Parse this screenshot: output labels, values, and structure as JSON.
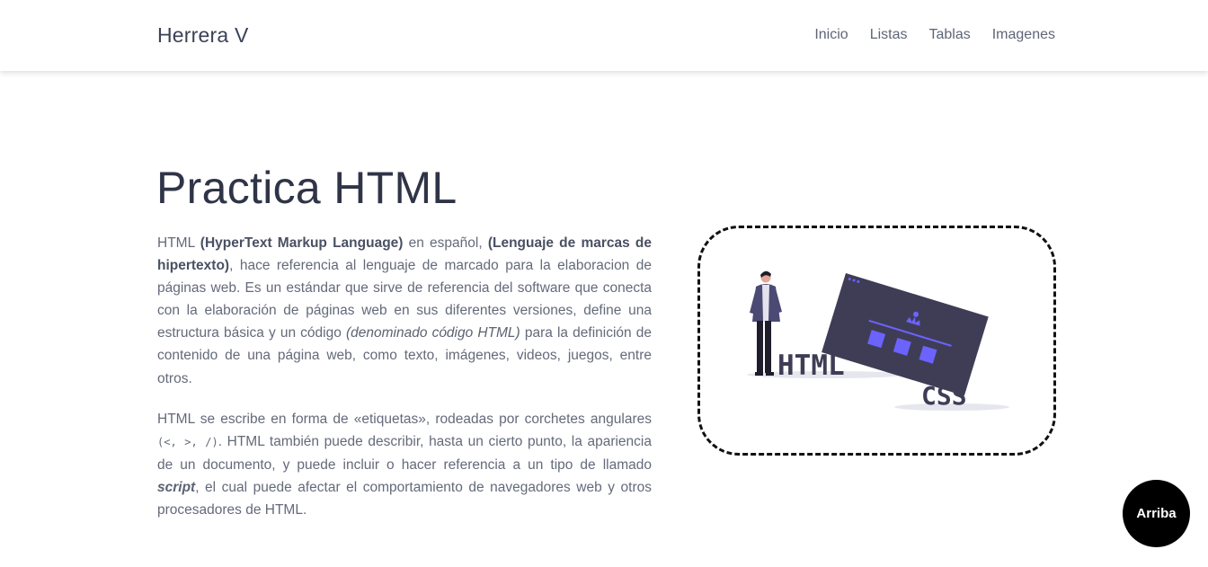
{
  "navbar": {
    "brand": "Herrera V",
    "links": [
      "Inicio",
      "Listas",
      "Tablas",
      "Imagenes"
    ]
  },
  "main": {
    "title": "Practica HTML",
    "paragraph1": {
      "t1": "HTML ",
      "b1": "(HyperText Markup Language)",
      "t2": " en español, ",
      "b2": "(Lenguaje de marcas de hipertexto)",
      "t3": ", hace referencia al lenguaje de marcado para la elaboracion de páginas web. Es un estándar que sirve de referencia del software que conecta con la elaboración de páginas web en sus diferentes versiones, define una estructura básica y un código ",
      "i1": "(denominado código HTML)",
      "t4": " para la definición de contenido de una página web, como texto, imágenes, videos, juegos, entre otros."
    },
    "paragraph2": {
      "t1": "HTML se escribe en forma de «etiquetas», rodeadas por corchetes angulares ",
      "code": "(<, >, /)",
      "t2": ". HTML también puede describir, hasta un cierto punto, la apariencia de un documento, y puede incluir o hacer referencia a un tipo de llamado ",
      "bi": "script",
      "t3": ", el cual puede afectar el comportamiento de navegadores web y otros procesadores de HTML."
    },
    "illustration": {
      "label_html": "HTML",
      "label_css": "CSS",
      "accent_color": "#6c63ff",
      "dark_color": "#3f3d56"
    }
  },
  "scroll_top_button": "Arriba"
}
